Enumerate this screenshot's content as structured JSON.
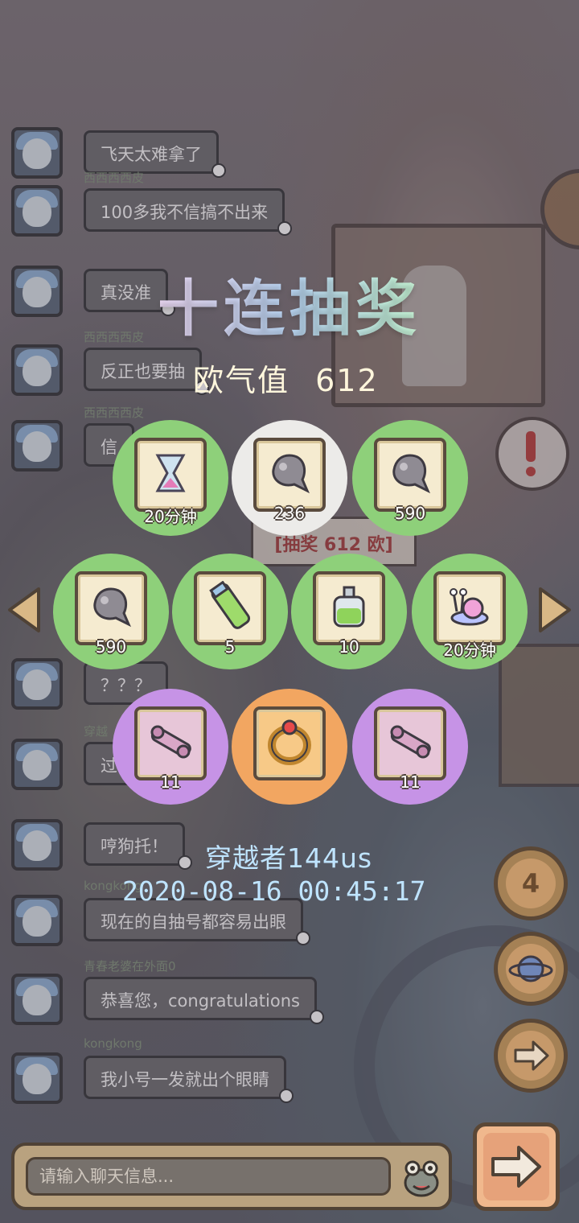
{
  "chat": {
    "messages": [
      {
        "user": "",
        "text": "飞天太难拿了"
      },
      {
        "user": "西西西西皮",
        "text": "100多我不信搞不出来"
      },
      {
        "user": "",
        "text": "真没准"
      },
      {
        "user": "西西西西皮",
        "text": "反正也要抽"
      },
      {
        "user": "西西西西皮",
        "text": "信"
      },
      {
        "user": "",
        "text": "？？？"
      },
      {
        "user": "穿越",
        "text": "过"
      },
      {
        "user": "",
        "text": "哼狗托！"
      },
      {
        "user": "kongkong",
        "text": "现在的自抽号都容易出眼"
      },
      {
        "user": "青春老婆在外面0",
        "text": "恭喜您，congratulations"
      },
      {
        "user": "kongkong",
        "text": "我小号一发就出个眼睛"
      }
    ],
    "input_placeholder": "请输入聊天信息..."
  },
  "draw": {
    "title": "十连抽奖",
    "luck_label": "欧气值",
    "luck_value": "612",
    "bg_tag": "[抽奖 612 欧]"
  },
  "rewards": [
    {
      "icon": "hourglass-icon",
      "rarity": "green",
      "count": "20分钟"
    },
    {
      "icon": "ghost-blob-icon",
      "rarity": "white",
      "count": "236"
    },
    {
      "icon": "ghost-blob-icon",
      "rarity": "green",
      "count": "590"
    },
    {
      "icon": "ghost-blob-icon",
      "rarity": "green",
      "count": "590"
    },
    {
      "icon": "green-tube-icon",
      "rarity": "green",
      "count": "5"
    },
    {
      "icon": "potion-bottle-icon",
      "rarity": "green",
      "count": "10"
    },
    {
      "icon": "snail-icon",
      "rarity": "green",
      "count": "20分钟"
    },
    {
      "icon": "telescope-icon",
      "rarity": "purple",
      "count": "11"
    },
    {
      "icon": "ring-icon",
      "rarity": "orange",
      "count": ""
    },
    {
      "icon": "telescope-icon",
      "rarity": "purple",
      "count": "11"
    }
  ],
  "winner": {
    "name": "穿越者144us",
    "time": "2020-08-16 00:45:17"
  },
  "side": {
    "badge_count": "4"
  },
  "colors": {
    "green": "#8ed07a",
    "white": "#ecebe9",
    "purple": "#c693e6",
    "orange": "#f2a661",
    "winner_text": "#bfe4ff"
  }
}
